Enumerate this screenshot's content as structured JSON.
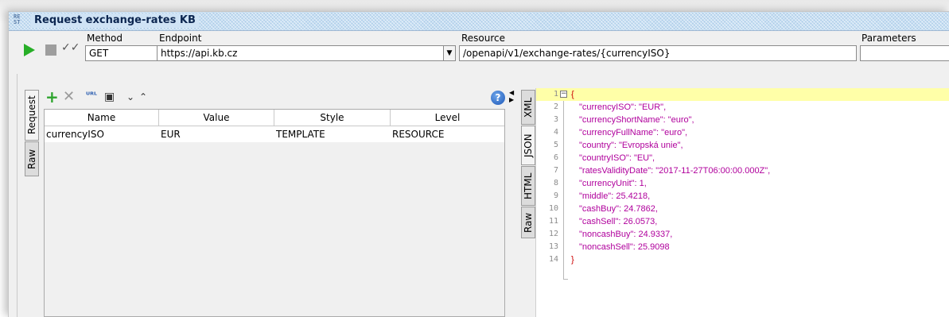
{
  "window": {
    "title": "Request exchange-rates KB",
    "icon_text": "RE ST"
  },
  "toolbar": {
    "method_label": "Method",
    "method_value": "GET",
    "endpoint_label": "Endpoint",
    "endpoint_value": "https://api.kb.cz",
    "resource_label": "Resource",
    "resource_value": "/openapi/v1/exchange-rates/{currencyISO}",
    "parameters_label": "Parameters",
    "parameters_value": ""
  },
  "left_tabs": [
    "Request",
    "Raw"
  ],
  "params_table": {
    "columns": [
      "Name",
      "Value",
      "Style",
      "Level"
    ],
    "rows": [
      {
        "name": "currencyISO",
        "value": "EUR",
        "style": "TEMPLATE",
        "level": "RESOURCE"
      }
    ]
  },
  "right_tabs": [
    "XML",
    "JSON",
    "HTML",
    "Raw"
  ],
  "response_lines": [
    {
      "n": "1",
      "text": "{"
    },
    {
      "n": "2",
      "text": "\"currencyISO\": \"EUR\","
    },
    {
      "n": "3",
      "text": "\"currencyShortName\": \"euro\","
    },
    {
      "n": "4",
      "text": "\"currencyFullName\": \"euro\","
    },
    {
      "n": "5",
      "text": "\"country\": \"Evropská unie\","
    },
    {
      "n": "6",
      "text": "\"countryISO\": \"EU\","
    },
    {
      "n": "7",
      "text": "\"ratesValidityDate\": \"2017-11-27T06:00:00.000Z\","
    },
    {
      "n": "8",
      "text": "\"currencyUnit\": 1,"
    },
    {
      "n": "9",
      "text": "\"middle\": 25.4218,"
    },
    {
      "n": "10",
      "text": "\"cashBuy\": 24.7862,"
    },
    {
      "n": "11",
      "text": "\"cashSell\": 26.0573,"
    },
    {
      "n": "12",
      "text": "\"noncashBuy\": 24.9337,"
    },
    {
      "n": "13",
      "text": "\"noncashSell\": 25.9098"
    },
    {
      "n": "14",
      "text": "}"
    }
  ],
  "colors": {
    "json_key": "#b0009c",
    "brace": "#cc0000",
    "highlight": "#ffffa8",
    "run": "#27ae27"
  },
  "icons": [
    "run-icon",
    "stop-icon",
    "check-icon",
    "add-icon",
    "delete-icon",
    "encode-icon",
    "swap-icon",
    "move-down-icon",
    "move-up-icon",
    "help-icon"
  ]
}
